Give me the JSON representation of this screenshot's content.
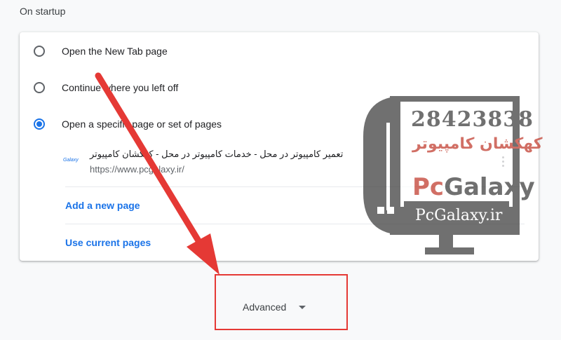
{
  "section": {
    "title": "On startup"
  },
  "startup_options": [
    {
      "label": "Open the New Tab page",
      "selected": false
    },
    {
      "label": "Continue where you left off",
      "selected": false
    },
    {
      "label": "Open a specific page or set of pages",
      "selected": true
    }
  ],
  "pages": [
    {
      "favicon_text": "Galaxy",
      "title": "تعمیر کامپیوتر در محل - خدمات کامپیوتر در محل - کهکشان کامپیوتر",
      "url": "https://www.pcgalaxy.ir/"
    }
  ],
  "actions": {
    "add_page": "Add a new page",
    "use_current": "Use current pages"
  },
  "advanced": {
    "label": "Advanced"
  },
  "watermark": {
    "phone": "28423838",
    "brand_fa": "کهکشان کامپیوتر",
    "brand_en_prefix": "Pc",
    "brand_en_suffix": "Galaxy",
    "domain": "PcGalaxy.ir"
  },
  "colors": {
    "accent": "#1a73e8",
    "annotation_red": "#e53935",
    "watermark_red": "#c0392b"
  }
}
